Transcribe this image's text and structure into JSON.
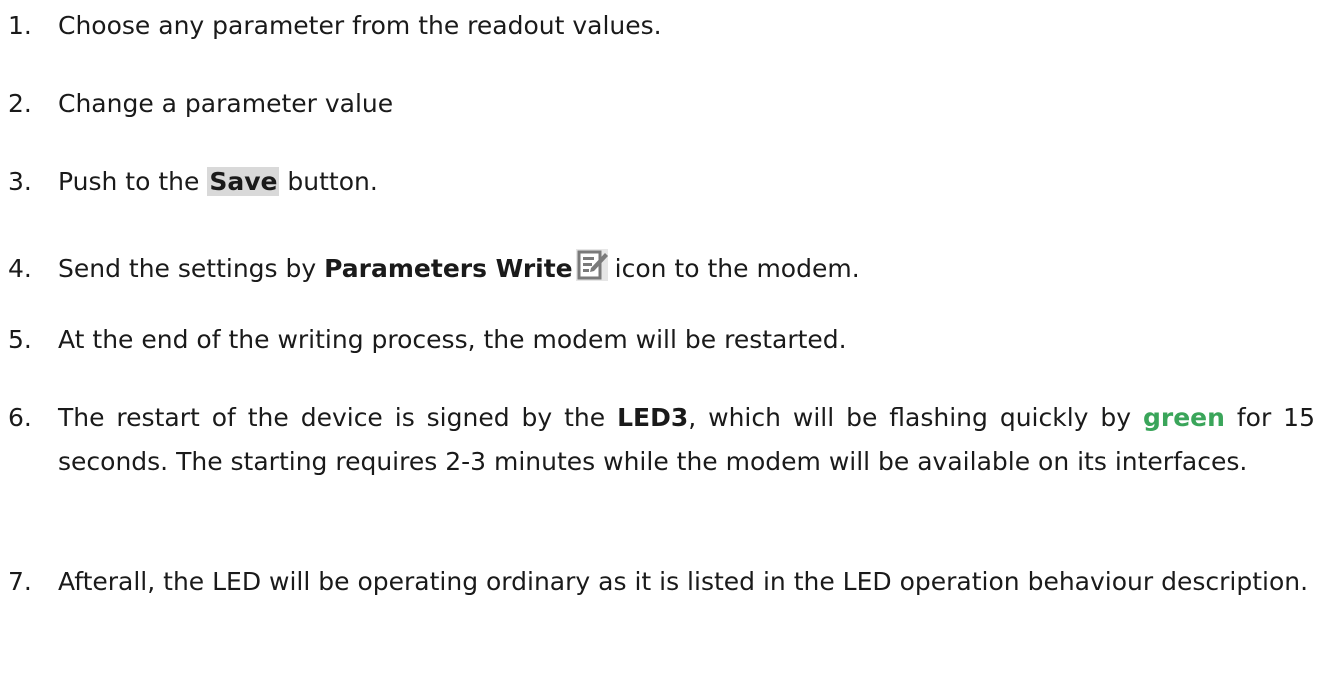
{
  "steps": [
    {
      "num": "1.",
      "text": "Choose any parameter from the readout values."
    },
    {
      "num": "2.",
      "text": "Change a parameter value"
    },
    {
      "num": "3.",
      "pre": "Push to the ",
      "bold": "Save",
      "post": " button."
    },
    {
      "num": "4.",
      "pre": "Send the settings by ",
      "bold": "Parameters Write",
      "icon": "edit-document-icon",
      "post": "icon to the modem."
    },
    {
      "num": "5.",
      "text": "At the end of the writing process, the modem will be restarted."
    },
    {
      "num": "6.",
      "pre": "The restart of the device is signed by the ",
      "bold": "LED3",
      "mid": ", which will be flashing quickly by ",
      "green": "green",
      "post": " for 15 seconds. The starting requires 2-3 minutes while the modem will be available on its interfaces."
    },
    {
      "num": "7.",
      "text": "Afterall, the LED will be operating ordinary as it is listed in the LED operation behaviour description."
    }
  ],
  "colors": {
    "text": "#1a1a1a",
    "green": "#3aa55a",
    "save_highlight": "#d9d9d9",
    "icon_gray": "#7a7a7a"
  }
}
